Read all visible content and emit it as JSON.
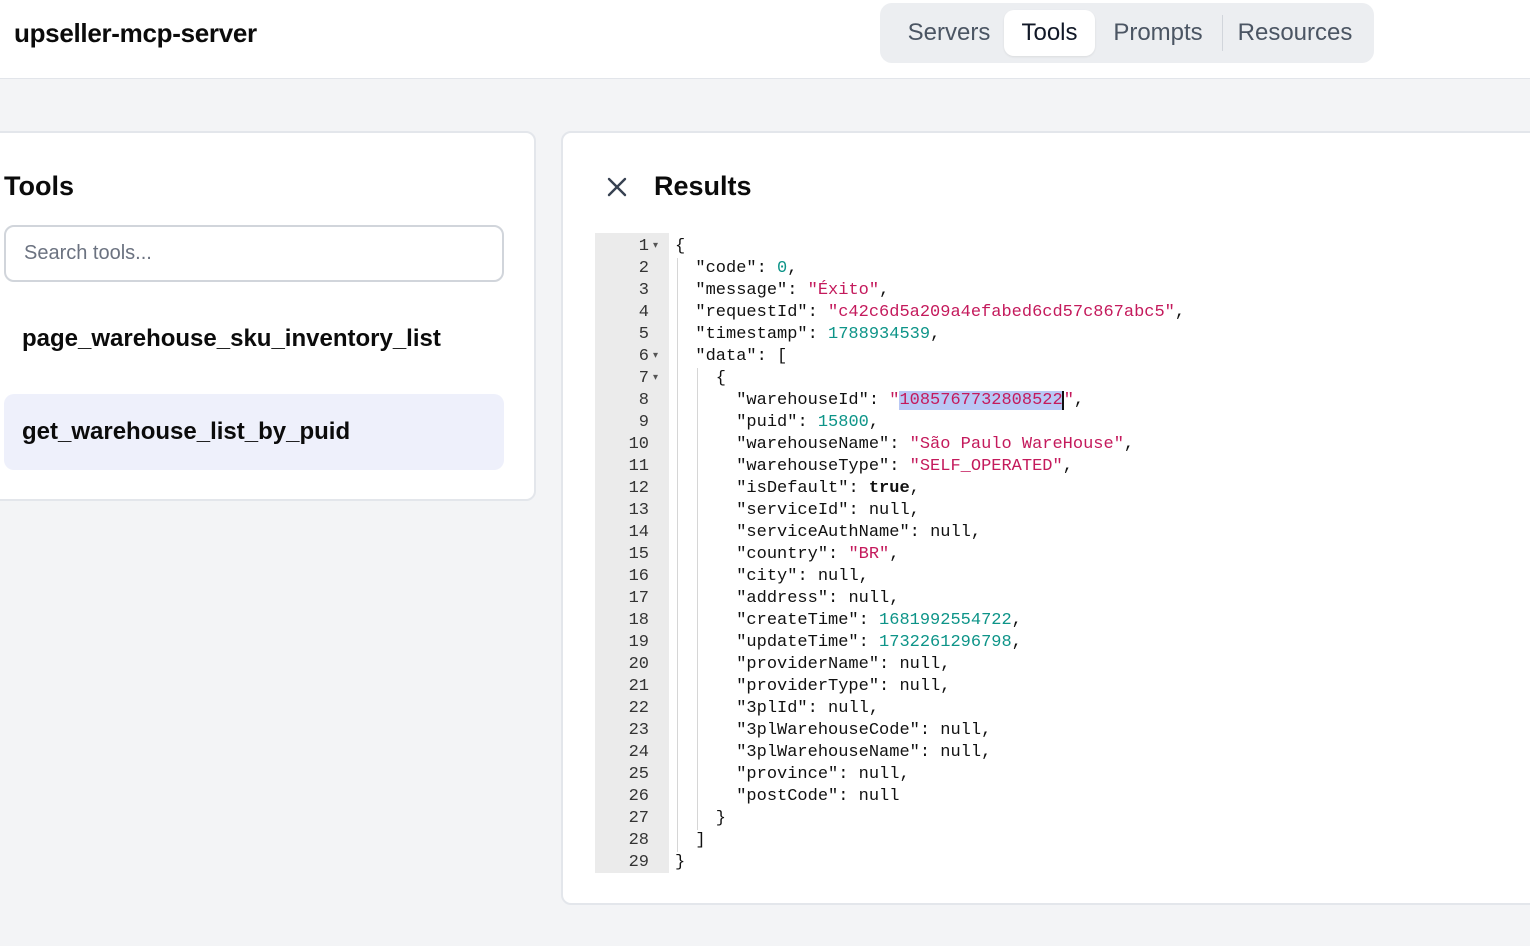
{
  "app": {
    "title": "upseller-mcp-server"
  },
  "nav": {
    "tabs": [
      "Servers",
      "Tools",
      "Prompts",
      "Resources"
    ],
    "active": "Tools"
  },
  "tools_panel": {
    "title": "Tools",
    "search_placeholder": "Search tools...",
    "items": [
      "page_warehouse_sku_inventory_list",
      "get_warehouse_list_by_puid"
    ],
    "selected": "get_warehouse_list_by_puid"
  },
  "results_panel": {
    "title": "Results",
    "close_icon": "close-icon",
    "json_lines": [
      "{",
      "  \"code\": 0,",
      "  \"message\": \"Éxito\",",
      "  \"requestId\": \"c42c6d5a209a4efabed6cd57c867abc5\",",
      "  \"timestamp\": 1788934539,",
      "  \"data\": [",
      "    {",
      "      \"warehouseId\": \"1085767732808522\",",
      "      \"puid\": 15800,",
      "      \"warehouseName\": \"São Paulo WareHouse\",",
      "      \"warehouseType\": \"SELF_OPERATED\",",
      "      \"isDefault\": true,",
      "      \"serviceId\": null,",
      "      \"serviceAuthName\": null,",
      "      \"country\": \"BR\",",
      "      \"city\": null,",
      "      \"address\": null,",
      "      \"createTime\": 1681992554722,",
      "      \"updateTime\": 1732261296798,",
      "      \"providerName\": null,",
      "      \"providerType\": null,",
      "      \"3plId\": null,",
      "      \"3plWarehouseCode\": null,",
      "      \"3plWarehouseName\": null,",
      "      \"province\": null,",
      "      \"postCode\": null",
      "    }",
      "  ]",
      "}"
    ],
    "fold_lines": [
      1,
      6,
      7
    ],
    "highlight": {
      "line": 8,
      "text": "1085767732808522"
    }
  },
  "colors": {
    "accent_selected_bg": "#eef0fb",
    "json_string": "#c41a5c",
    "json_number": "#0d9488",
    "selection": "#b9c8f5"
  }
}
